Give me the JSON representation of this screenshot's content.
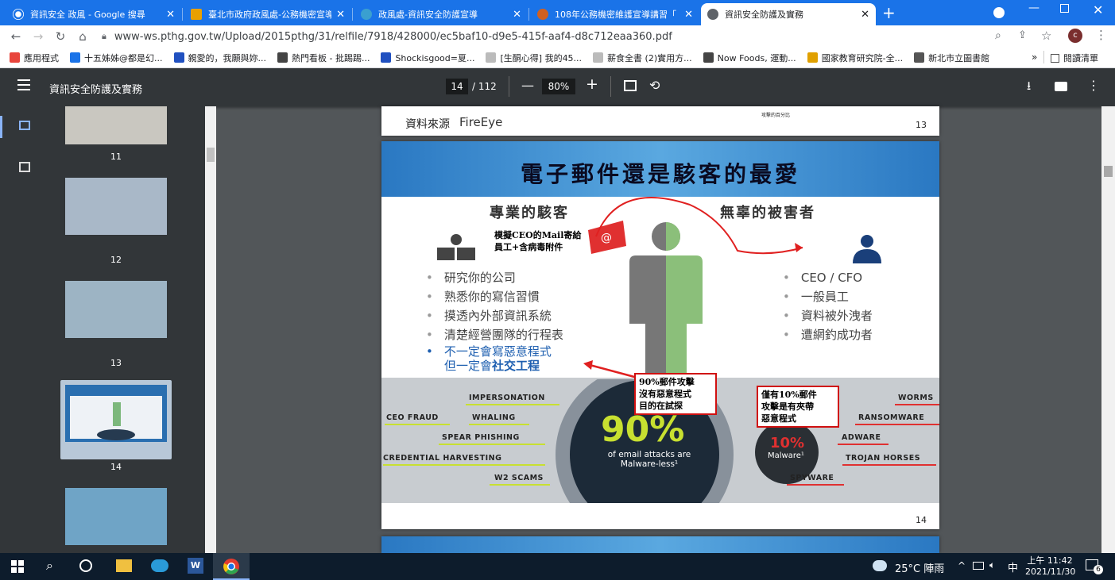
{
  "tabs": [
    {
      "title": "資訊安全 政風 - Google 搜尋",
      "color": "#4285f4",
      "active": false
    },
    {
      "title": "臺北市政府政風處-公務機密宣導",
      "color": "#e8a000",
      "active": false
    },
    {
      "title": "政風處-資訊安全防護宣導",
      "color": "#3aa0d0",
      "active": false
    },
    {
      "title": "108年公務機密維護宣導講習「",
      "color": "#d06020",
      "active": false
    },
    {
      "title": "資訊安全防護及實務",
      "color": "#5f6368",
      "active": true
    }
  ],
  "address": {
    "url": "www-ws.pthg.gov.tw/Upload/2015pthg/31/relfile/7918/428000/ec5baf10-d9e5-415f-aaf4-d8c712eaa360.pdf"
  },
  "profile": {
    "initial": "c"
  },
  "bookmarks": [
    {
      "label": "應用程式",
      "color": "#e8453c"
    },
    {
      "label": "十五姊姊@都是幻...",
      "color": "#1a73e8"
    },
    {
      "label": "親愛的，我願與妳...",
      "color": "#2050c0"
    },
    {
      "label": "熱門看板 - 批踢踢...",
      "color": "#444"
    },
    {
      "label": "Shockisgood=夏...",
      "color": "#2050c0"
    },
    {
      "label": "[生酮心得] 我的45...",
      "color": "#bbb"
    },
    {
      "label": "薪食全書 (2)實用方...",
      "color": "#bbb"
    },
    {
      "label": "Now Foods, 運動...",
      "color": "#444"
    },
    {
      "label": "國家教育研究院-全...",
      "color": "#e0a000"
    },
    {
      "label": "新北市立圖書館",
      "color": "#555"
    }
  ],
  "bookmarks_more": "»",
  "reading_list": "閱讀清單",
  "pdf": {
    "title": "資訊安全防護及實務",
    "page_current": "14",
    "page_total": "/ 112",
    "zoom": "80%"
  },
  "thumbnails": [
    {
      "num": "11",
      "selected": false
    },
    {
      "num": "12",
      "selected": false
    },
    {
      "num": "13",
      "selected": false
    },
    {
      "num": "14",
      "selected": true
    },
    {
      "num": "",
      "selected": false
    }
  ],
  "prev_page": {
    "source_label": "資料來源",
    "source_brand": "FireEye",
    "small_text": "攻擊的百分比",
    "page_no": "13"
  },
  "slide": {
    "title": "電子郵件還是駭客的最愛",
    "left_heading": "專業的駭客",
    "right_heading": "無辜的被害者",
    "mail_note": [
      "模擬CEO的Mail寄給",
      "員工+含病毒附件"
    ],
    "left_items": [
      "研究你的公司",
      "熟悉你的寫信習慣",
      "摸透內外部資訊系統",
      "清楚經營團隊的行程表"
    ],
    "left_highlight": [
      "不一定會寫惡意程式",
      "但一定會"
    ],
    "left_highlight_bold": "社交工程",
    "right_items": [
      "CEO / CFO",
      "一般員工",
      "資料被外洩者",
      "遭網釣成功者"
    ],
    "box_90": [
      "90%郵件攻擊",
      "沒有惡意程式",
      "目的在試探"
    ],
    "box_10": [
      "僅有10%郵件",
      "攻擊是有夾帶",
      "惡意程式"
    ],
    "big_pct": "90%",
    "big_caption": [
      "of email attacks are",
      "Malware-less¹"
    ],
    "small_pct": "10%",
    "small_caption": "Malware¹",
    "left_keywords": [
      "IMPERSONATION",
      "CEO FRAUD",
      "WHALING",
      "SPEAR PHISHING",
      "CREDENTIAL HARVESTING",
      "W2 SCAMS"
    ],
    "right_keywords": [
      "WORMS",
      "RANSOMWARE",
      "ADWARE",
      "TROJAN HORSES",
      "SPYWARE"
    ],
    "page_no": "14"
  },
  "taskbar": {
    "weather": "25°C 陣雨",
    "ime": "中",
    "time": "上午 11:42",
    "date": "2021/11/30",
    "notif": "6"
  }
}
